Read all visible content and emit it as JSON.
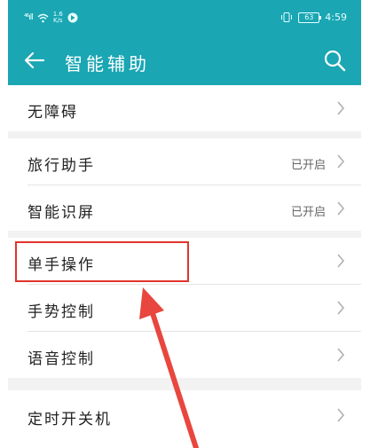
{
  "status_bar": {
    "signal_text": "⁴⁶ıll",
    "speed_top": "1.6",
    "speed_bottom": "K/s",
    "battery_level": "63",
    "time": "4:59"
  },
  "app_bar": {
    "title": "智能辅助",
    "back_icon": "back-arrow-icon",
    "search_icon": "search-icon"
  },
  "colors": {
    "header": "#1aa6b3",
    "highlight": "#e0342c",
    "arrow": "#e8463e"
  },
  "groups": [
    {
      "items": [
        {
          "label": "无障碍",
          "value": ""
        }
      ]
    },
    {
      "items": [
        {
          "label": "旅行助手",
          "value": "已开启"
        },
        {
          "label": "智能识屏",
          "value": "已开启"
        }
      ]
    },
    {
      "items": [
        {
          "label": "单手操作",
          "value": ""
        },
        {
          "label": "手势控制",
          "value": ""
        },
        {
          "label": "语音控制",
          "value": ""
        }
      ]
    },
    {
      "items": [
        {
          "label": "定时开关机",
          "value": ""
        }
      ]
    }
  ]
}
